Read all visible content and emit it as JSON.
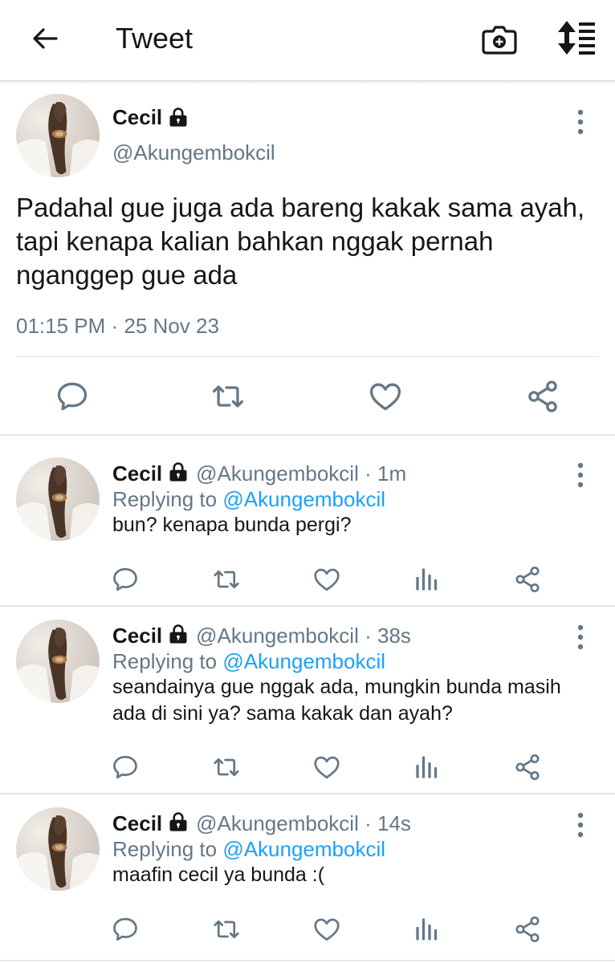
{
  "header": {
    "title": "Tweet",
    "back_icon": "arrow-left-icon",
    "camera_icon": "camera-plus-icon",
    "sort_icon": "sort-list-icon"
  },
  "main_tweet": {
    "name": "Cecil",
    "handle": "@Akungembokcil",
    "text": "Padahal gue juga ada bareng kakak sama ayah, tapi kenapa kalian bahkan nggak pernah nganggep gue ada",
    "timestamp": "01:15 PM · 25 Nov 23",
    "actions": [
      "reply-icon",
      "retweet-icon",
      "like-icon",
      "share-icon"
    ]
  },
  "replies": [
    {
      "name": "Cecil",
      "handle": "@Akungembokcil",
      "time": "1m",
      "replying_label": "Replying to",
      "replying_to": "@Akungembokcil",
      "text": "bun? kenapa bunda pergi?"
    },
    {
      "name": "Cecil",
      "handle": "@Akungembokcil",
      "time": "38s",
      "replying_label": "Replying to",
      "replying_to": "@Akungembokcil",
      "text": "seandainya gue nggak ada, mungkin bunda masih ada di sini ya? sama kakak dan ayah?"
    },
    {
      "name": "Cecil",
      "handle": "@Akungembokcil",
      "time": "14s",
      "replying_label": "Replying to",
      "replying_to": "@Akungembokcil",
      "text": "maafin cecil ya bunda :("
    }
  ],
  "colors": {
    "text": "#14171a",
    "secondary": "#657786",
    "mention": "#1da1f2",
    "divider": "#e1e8ed"
  }
}
